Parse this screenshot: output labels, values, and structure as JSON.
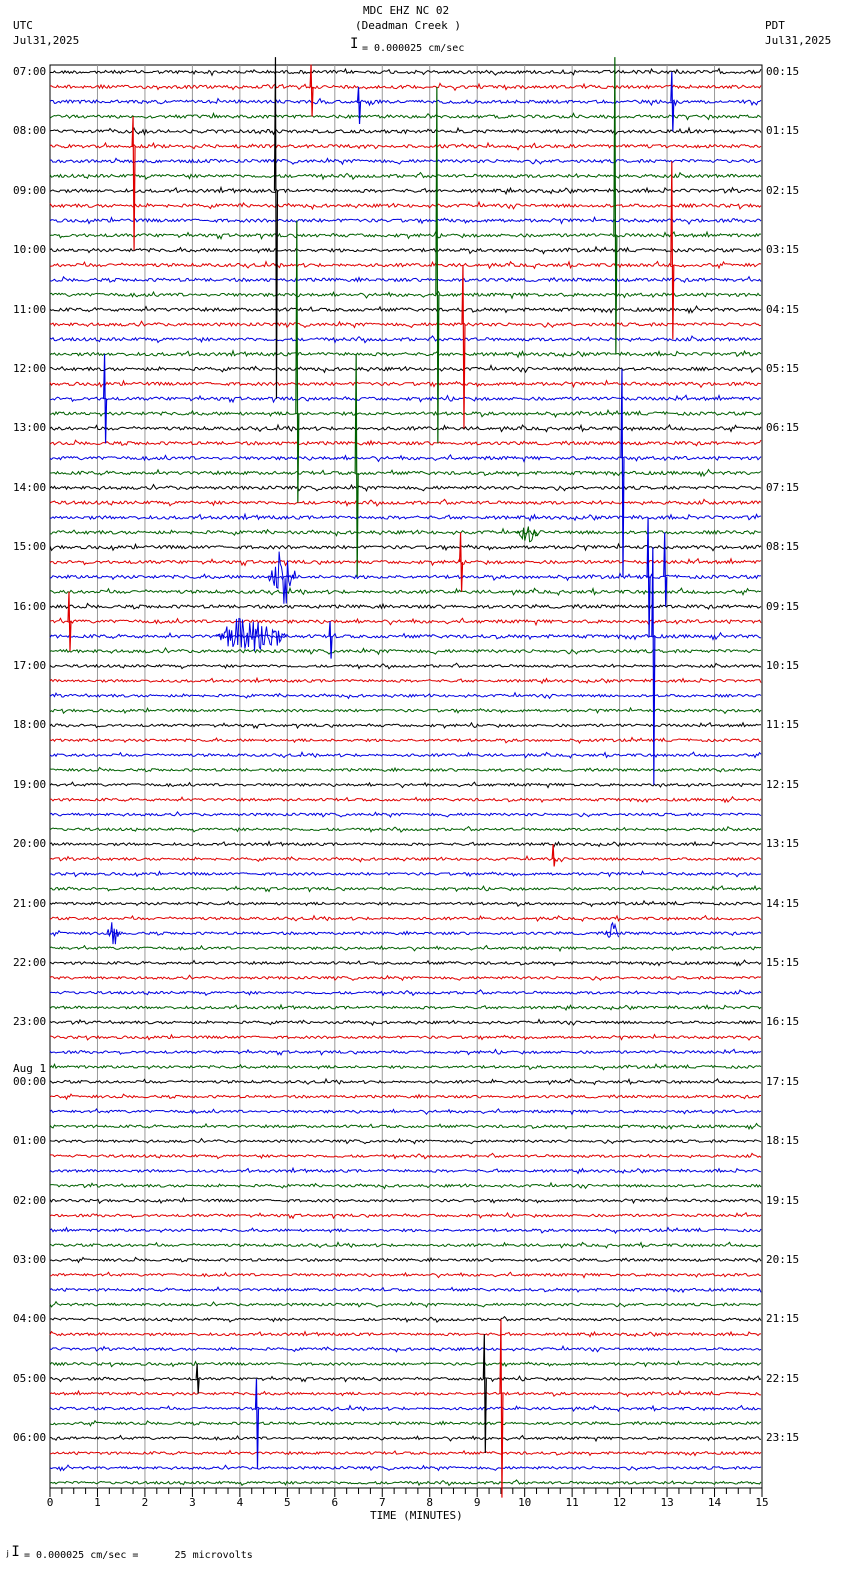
{
  "chart_data": {
    "type": "line",
    "title": "MDC EHZ NC 02",
    "subtitle": "(Deadman Creek )",
    "left_timezone": "UTC",
    "left_date": "Jul31,2025",
    "right_timezone": "PDT",
    "right_date": "Jul31,2025",
    "scale_label": "= 0.000025 cm/sec",
    "footer_label": "= 0.000025 cm/sec =      25 microvolts",
    "xlabel": "TIME (MINUTES)",
    "xlim": [
      0,
      15
    ],
    "x_ticks": [
      "0",
      "1",
      "2",
      "3",
      "4",
      "5",
      "6",
      "7",
      "8",
      "9",
      "10",
      "11",
      "12",
      "13",
      "14",
      "15"
    ],
    "grid": true,
    "traces_per_hour": 4,
    "trace_count": 96,
    "trace_colors": [
      "#000000",
      "#e00000",
      "#0000e0",
      "#006000"
    ],
    "left_hour_labels": [
      "07:00",
      "08:00",
      "09:00",
      "10:00",
      "11:00",
      "12:00",
      "13:00",
      "14:00",
      "15:00",
      "16:00",
      "17:00",
      "18:00",
      "19:00",
      "20:00",
      "21:00",
      "22:00",
      "23:00",
      "00:00",
      "01:00",
      "02:00",
      "03:00",
      "04:00",
      "05:00",
      "06:00"
    ],
    "date_change_label": "Aug 1",
    "date_change_hour_index": 17,
    "right_hour_labels": [
      "00:15",
      "01:15",
      "02:15",
      "03:15",
      "04:15",
      "05:15",
      "06:15",
      "07:15",
      "08:15",
      "09:15",
      "10:15",
      "11:15",
      "12:15",
      "13:15",
      "14:15",
      "15:15",
      "16:15",
      "17:15",
      "18:15",
      "19:15",
      "20:15",
      "21:15",
      "22:15",
      "23:15"
    ],
    "events": [
      {
        "trace": 8,
        "minute": 4.75,
        "up": 9,
        "down": 14,
        "kind": "spike"
      },
      {
        "trace": 11,
        "minute": 11.9,
        "up": 12,
        "down": 8,
        "kind": "spike"
      },
      {
        "trace": 2,
        "minute": 13.1,
        "up": 2,
        "down": 2,
        "kind": "spike"
      },
      {
        "trace": 13,
        "minute": 13.1,
        "up": 7,
        "down": 5,
        "kind": "spike"
      },
      {
        "trace": 5,
        "minute": 1.75,
        "up": 2,
        "down": 7,
        "kind": "spike"
      },
      {
        "trace": 1,
        "minute": 5.5,
        "up": 1.5,
        "down": 2,
        "kind": "spike"
      },
      {
        "trace": 2,
        "minute": 6.5,
        "up": 1,
        "down": 1.5,
        "kind": "spike"
      },
      {
        "trace": 15,
        "minute": 8.15,
        "up": 14,
        "down": 10,
        "kind": "spike"
      },
      {
        "trace": 17,
        "minute": 8.7,
        "up": 4,
        "down": 7,
        "kind": "spike"
      },
      {
        "trace": 23,
        "minute": 5.2,
        "up": 13,
        "down": 6,
        "kind": "spike"
      },
      {
        "trace": 27,
        "minute": 6.45,
        "up": 8,
        "down": 7,
        "kind": "spike"
      },
      {
        "trace": 26,
        "minute": 12.05,
        "up": 6,
        "down": 8,
        "kind": "spike"
      },
      {
        "trace": 34,
        "minute": 12.6,
        "up": 4,
        "down": 4,
        "kind": "spike"
      },
      {
        "trace": 38,
        "minute": 12.7,
        "up": 6,
        "down": 10,
        "kind": "spike"
      },
      {
        "trace": 34,
        "minute": 12.95,
        "up": 3,
        "down": 2,
        "kind": "spike"
      },
      {
        "trace": 33,
        "minute": 8.65,
        "up": 2,
        "down": 2,
        "kind": "spike"
      },
      {
        "trace": 37,
        "minute": 0.4,
        "up": 2,
        "down": 2,
        "kind": "spike"
      },
      {
        "trace": 22,
        "minute": 1.15,
        "up": 3,
        "down": 3,
        "kind": "spike"
      },
      {
        "trace": 38,
        "minute": 5.9,
        "up": 1,
        "down": 1.5,
        "kind": "spike"
      },
      {
        "trace": 34,
        "minute": 4.6,
        "up": 2,
        "down": 1,
        "kind": "burst",
        "length": 0.6
      },
      {
        "trace": 38,
        "minute": 3.5,
        "up": 1.5,
        "down": 1.5,
        "kind": "burst",
        "length": 1.5
      },
      {
        "trace": 58,
        "minute": 1.2,
        "up": 1,
        "down": 1,
        "kind": "burst",
        "length": 0.3
      },
      {
        "trace": 58,
        "minute": 11.7,
        "up": 1.2,
        "down": 1,
        "kind": "burst",
        "length": 0.3
      },
      {
        "trace": 31,
        "minute": 9.8,
        "up": 0.8,
        "down": 0.8,
        "kind": "burst",
        "length": 0.5
      },
      {
        "trace": 88,
        "minute": 9.15,
        "up": 3,
        "down": 5,
        "kind": "spike"
      },
      {
        "trace": 89,
        "minute": 9.5,
        "up": 5,
        "down": 7,
        "kind": "spike"
      },
      {
        "trace": 90,
        "minute": 4.35,
        "up": 2,
        "down": 4,
        "kind": "spike"
      },
      {
        "trace": 88,
        "minute": 3.1,
        "up": 1,
        "down": 1,
        "kind": "spike"
      },
      {
        "trace": 53,
        "minute": 10.6,
        "up": 1,
        "down": 0.5,
        "kind": "spike"
      }
    ]
  }
}
